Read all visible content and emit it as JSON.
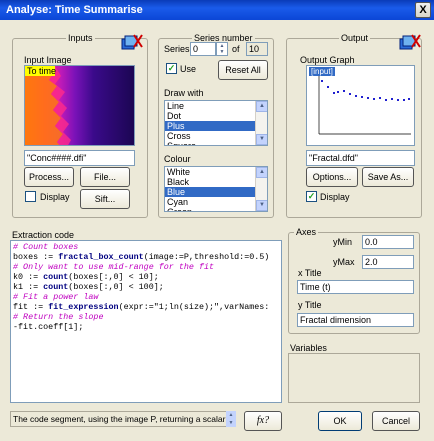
{
  "window": {
    "title": "Analyse: Time Summarise",
    "close_glyph": "X"
  },
  "inputs": {
    "group_title": "Inputs",
    "image_label": "Input Image",
    "overlay_text": "To time",
    "filename": "\"Conc####.dfi\"",
    "process_label": "Process...",
    "file_label": "File...",
    "display_label": "Display",
    "display_checked": false,
    "sift_label": "Sift..."
  },
  "series": {
    "group_title": "Series number",
    "series_label": "Series",
    "series_value": "0",
    "of_label": "of",
    "of_value": "10",
    "use_label": "Use",
    "use_checked": true,
    "reset_label": "Reset All",
    "draw_with_label": "Draw with",
    "draw_with_items": [
      "Line",
      "Dot",
      "Plus",
      "Cross",
      "Square"
    ],
    "draw_with_selected": "Plus",
    "colour_label": "Colour",
    "colour_items": [
      "White",
      "Black",
      "Blue",
      "Cyan",
      "Green"
    ],
    "colour_selected": "Blue"
  },
  "output": {
    "group_title": "Output",
    "graph_label": "Output Graph",
    "graph_legend": "[input]",
    "filename": "\"Fractal.dfd\"",
    "options_label": "Options...",
    "save_label": "Save As...",
    "display_label": "Display",
    "display_checked": true
  },
  "extraction": {
    "label": "Extraction code",
    "lines": [
      {
        "kind": "comment",
        "text": "# Count boxes"
      },
      {
        "kind": "call",
        "pre": "boxes := ",
        "fn": "fractal_box_count",
        "post": "(image:=P,threshold:=0.5)"
      },
      {
        "kind": "comment",
        "text": "# Only want to use mid-range for the fit"
      },
      {
        "kind": "call",
        "pre": "k0 := ",
        "fn": "count",
        "post": "(boxes[:,0] < 10];"
      },
      {
        "kind": "call",
        "pre": "k1 := ",
        "fn": "count",
        "post": "(boxes[:,0] < 100];"
      },
      {
        "kind": "comment",
        "text": "# Fit a power law"
      },
      {
        "kind": "call",
        "pre": "fit := ",
        "fn": "fit_expression",
        "post": "(expr:=\"1;ln(size);\",varNames:"
      },
      {
        "kind": "comment",
        "text": "# Return the slope"
      },
      {
        "kind": "plain",
        "text": "-fit.coeff[1];"
      }
    ],
    "status_text": "The code segment, using the image P, returning a scalar"
  },
  "axes": {
    "group_title": "Axes",
    "ymin_label": "yMin",
    "ymin_value": "0.0",
    "ymax_label": "yMax",
    "ymax_value": "2.0",
    "xtitle_label": "x Title",
    "xtitle_value": "Time (t)",
    "ytitle_label": "y Title",
    "ytitle_value": "Fractal dimension"
  },
  "variables": {
    "group_title": "Variables"
  },
  "footer": {
    "fx_label": "fx?",
    "ok_label": "OK",
    "cancel_label": "Cancel"
  },
  "colors": {
    "titlebar": "#0b46d6",
    "selection": "#316ac5",
    "comment": "#c000c0",
    "function": "#000080",
    "graph_points": "#2020d0"
  }
}
